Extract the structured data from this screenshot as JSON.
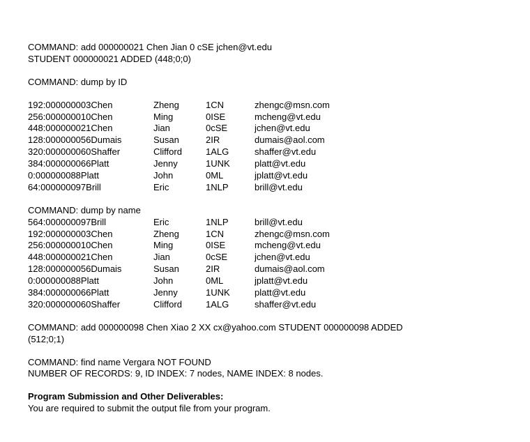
{
  "line_cmd_add1": "COMMAND: add 000000021 Chen Jian 0 cSE jchen@vt.edu",
  "line_student_added1": "STUDENT 000000021 ADDED (448;0;0)",
  "line_cmd_dump_id": "COMMAND: dump by ID",
  "table_id": [
    {
      "c1": "192:000000003Chen",
      "c2": "Zheng",
      "c3": "1CN",
      "c4": "zhengc@msn.com"
    },
    {
      "c1": "256:000000010Chen",
      "c2": "Ming",
      "c3": "0ISE",
      "c4": "mcheng@vt.edu"
    },
    {
      "c1": "448:000000021Chen",
      "c2": "Jian",
      "c3": "0cSE",
      "c4": "jchen@vt.edu"
    },
    {
      "c1": "128:000000056Dumais",
      "c2": "Susan",
      "c3": "2IR",
      "c4": "dumais@aol.com"
    },
    {
      "c1": "320:000000060Shaffer",
      "c2": "Clifford",
      "c3": "1ALG",
      "c4": "shaffer@vt.edu"
    },
    {
      "c1": "384:000000066Platt",
      "c2": "Jenny",
      "c3": "1UNK",
      "c4": "platt@vt.edu"
    },
    {
      "c1": "0:000000088Platt",
      "c2": "John",
      "c3": "0ML",
      "c4": "jplatt@vt.edu"
    },
    {
      "c1": "64:000000097Brill",
      "c2": "Eric",
      "c3": "1NLP",
      "c4": "brill@vt.edu"
    }
  ],
  "line_cmd_dump_name": "COMMAND: dump by name",
  "table_name": [
    {
      "c1": "564:000000097Brill",
      "c2": "Eric",
      "c3": "1NLP",
      "c4": "brill@vt.edu"
    },
    {
      "c1": "192:000000003Chen",
      "c2": "Zheng",
      "c3": "1CN",
      "c4": "zhengc@msn.com"
    },
    {
      "c1": "256:000000010Chen",
      "c2": "Ming",
      "c3": "0ISE",
      "c4": "mcheng@vt.edu"
    },
    {
      "c1": "448:000000021Chen",
      "c2": "Jian",
      "c3": "0cSE",
      "c4": "jchen@vt.edu"
    },
    {
      "c1": "128:000000056Dumais",
      "c2": "Susan",
      "c3": "2IR",
      "c4": "dumais@aol.com"
    },
    {
      "c1": "0:000000088Platt",
      "c2": "John",
      "c3": "0ML",
      "c4": "jplatt@vt.edu"
    },
    {
      "c1": "384:000000066Platt",
      "c2": "Jenny",
      "c3": "1UNK",
      "c4": "platt@vt.edu"
    },
    {
      "c1": "320:000000060Shaffer",
      "c2": "Clifford",
      "c3": "1ALG",
      "c4": "shaffer@vt.edu"
    }
  ],
  "line_cmd_add2a": "COMMAND: add 000000098 Chen Xiao 2 XX cx@yahoo.com STUDENT 000000098 ADDED",
  "line_cmd_add2b": "(512;0;1)",
  "line_cmd_find": "COMMAND: find name Vergara NOT FOUND",
  "line_num_records": "NUMBER OF RECORDS: 9, ID INDEX: 7 nodes, NAME INDEX: 8 nodes.",
  "heading_submission": "Program Submission and Other Deliverables:",
  "line_submission_body": "You are required to submit the output file from your program."
}
